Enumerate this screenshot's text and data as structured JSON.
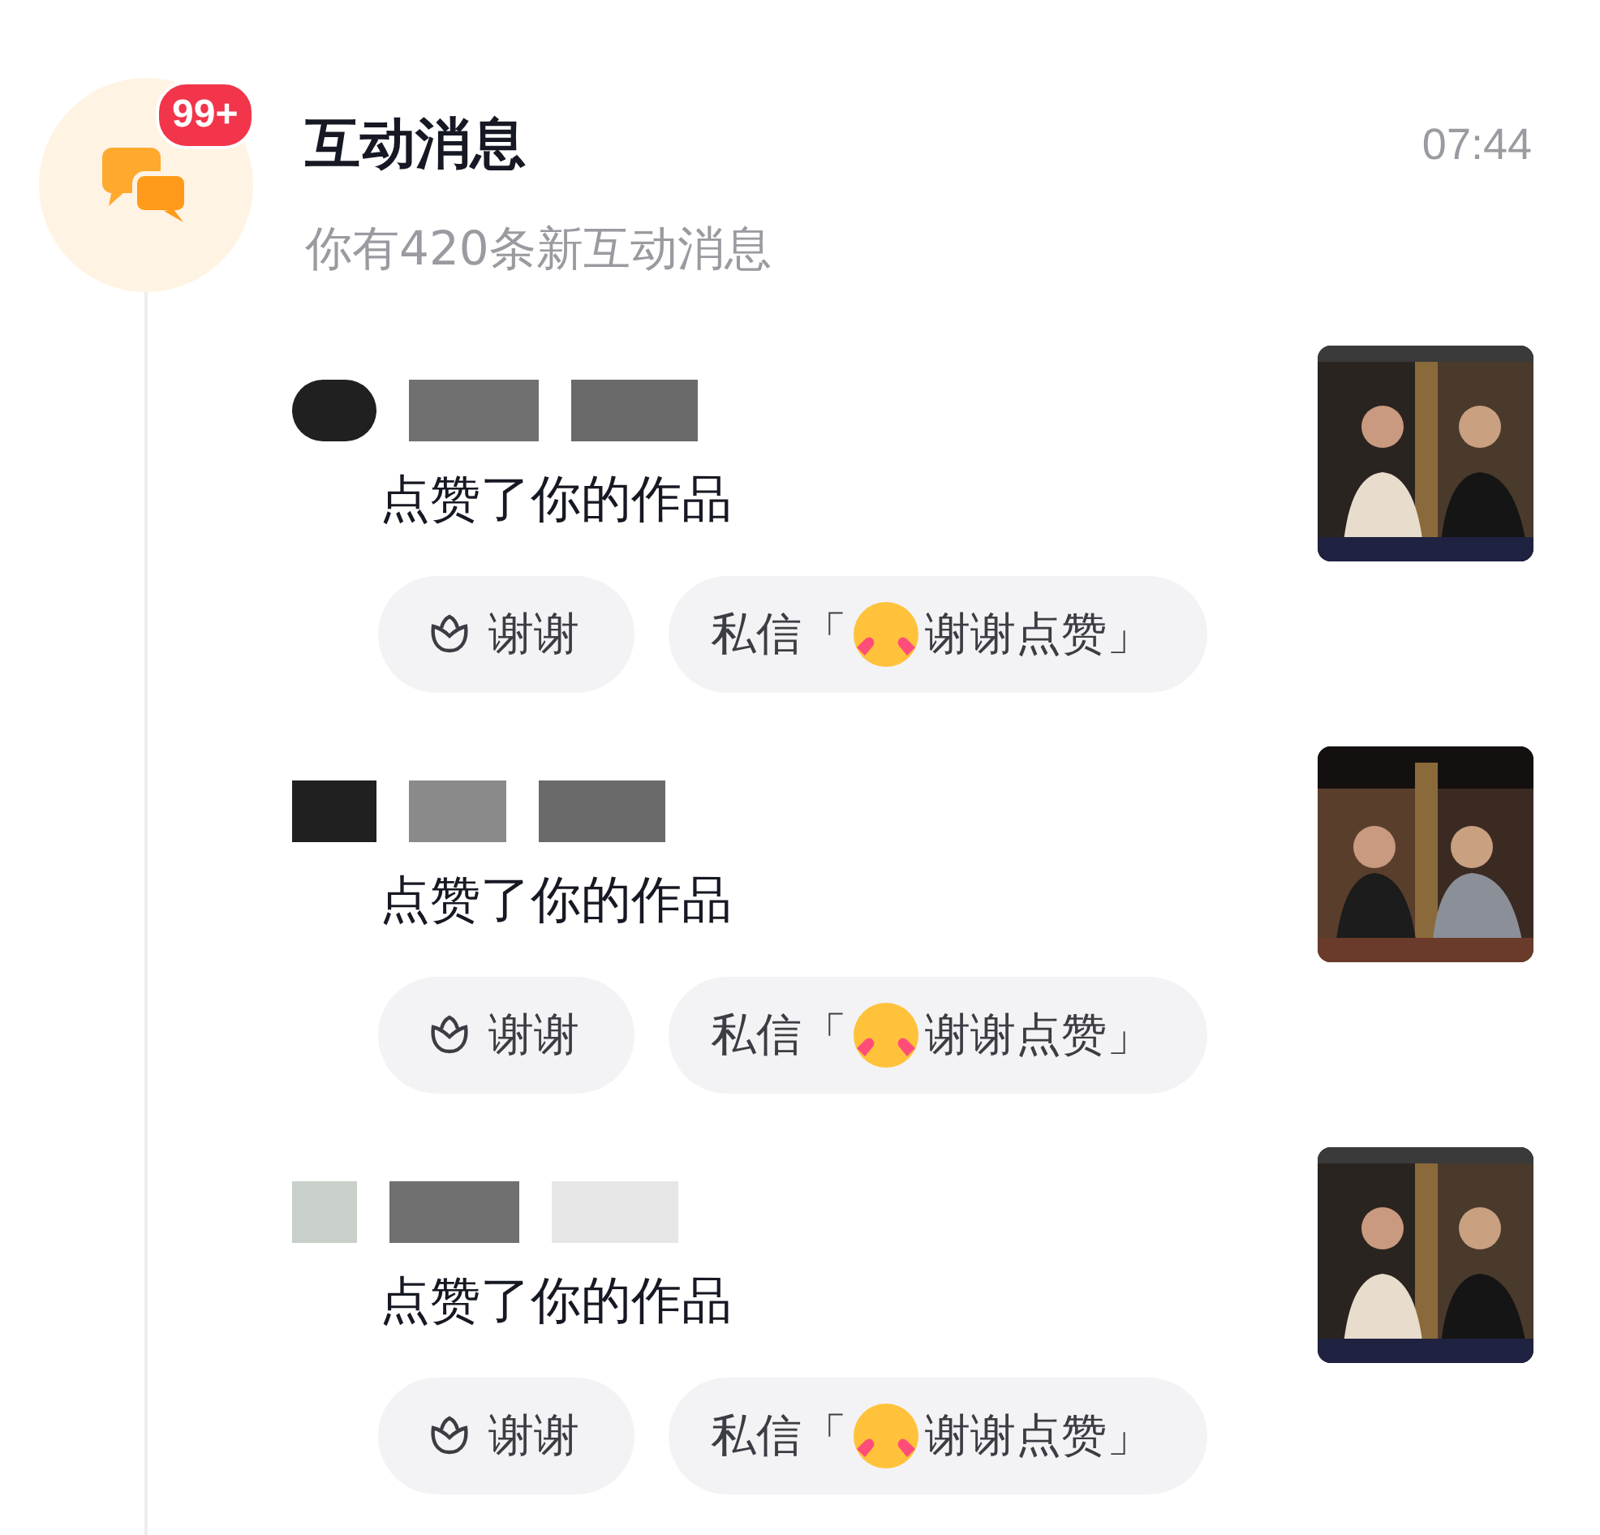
{
  "header": {
    "badge": "99+",
    "title": "互动消息",
    "time": "07:44",
    "subtitle": "你有420条新互动消息"
  },
  "notifications": [
    {
      "action": "点赞了你的作品",
      "thanks_button": "谢谢",
      "reply_prefix": "私信「",
      "reply_suffix": "谢谢点赞」"
    },
    {
      "action": "点赞了你的作品",
      "thanks_button": "谢谢",
      "reply_prefix": "私信「",
      "reply_suffix": "谢谢点赞」"
    },
    {
      "action": "点赞了你的作品",
      "thanks_button": "谢谢",
      "reply_prefix": "私信「",
      "reply_suffix": "谢谢点赞」"
    }
  ]
}
